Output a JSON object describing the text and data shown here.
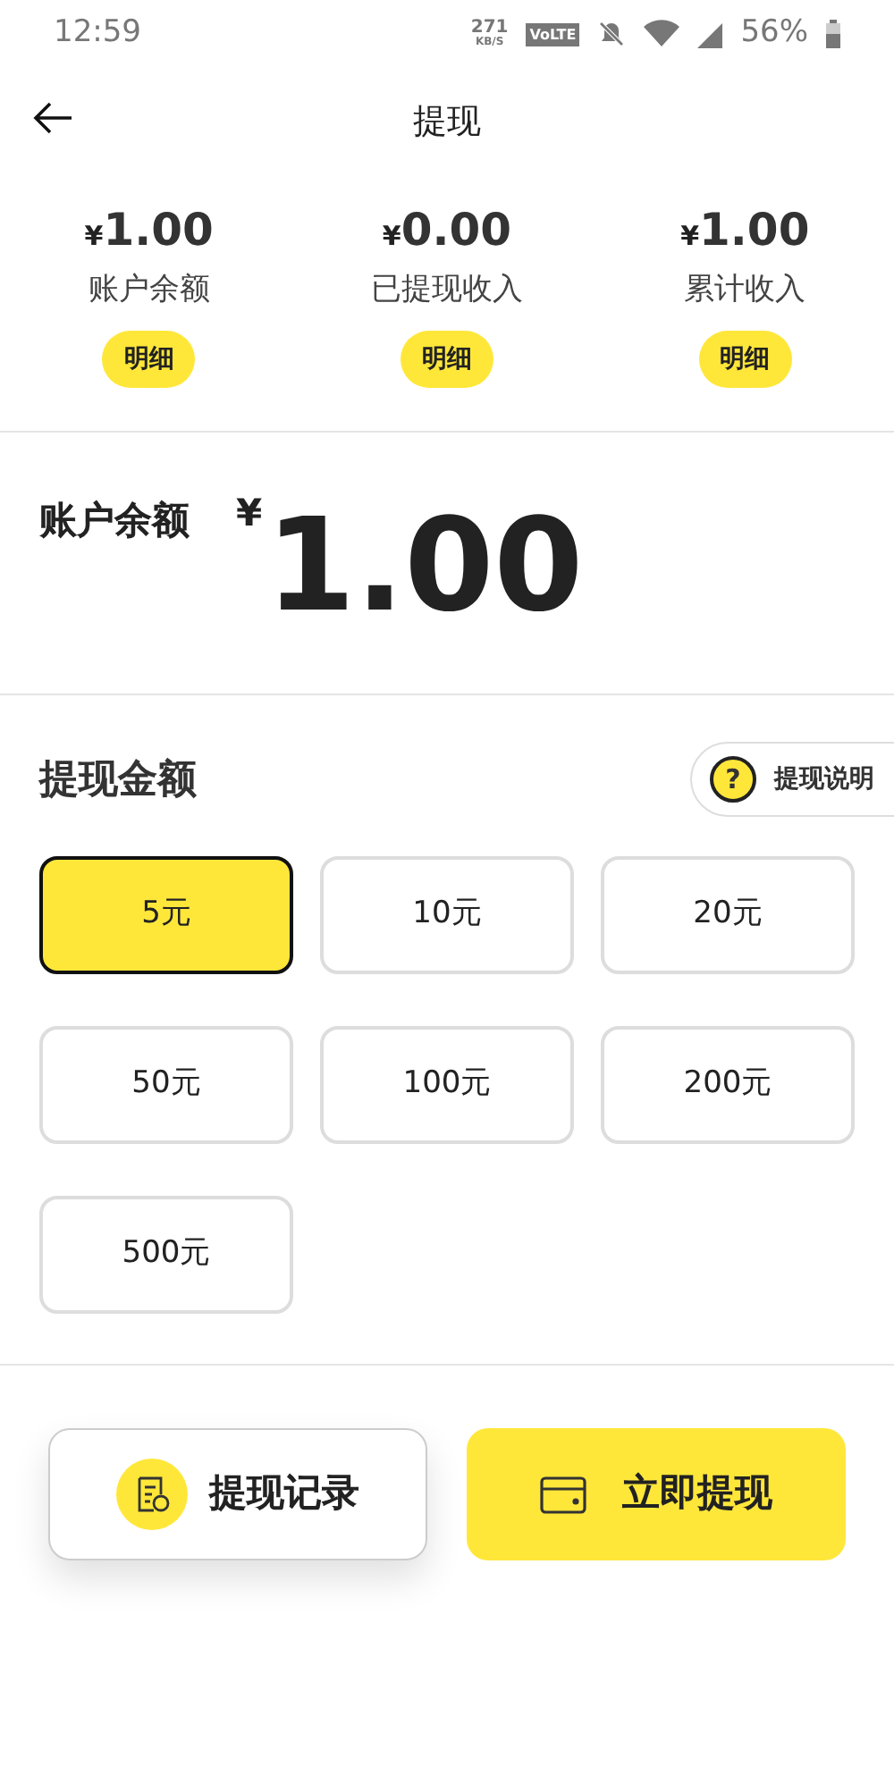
{
  "status_bar": {
    "time": "12:59",
    "speed": "271",
    "speed_unit": "KB/S",
    "network": "VoLTE",
    "battery": "56%"
  },
  "header": {
    "title": "提现"
  },
  "stats": [
    {
      "currency": "¥",
      "amount": "1.00",
      "label": "账户余额",
      "button": "明细"
    },
    {
      "currency": "¥",
      "amount": "0.00",
      "label": "已提现收入",
      "button": "明细"
    },
    {
      "currency": "¥",
      "amount": "1.00",
      "label": "累计收入",
      "button": "明细"
    }
  ],
  "balance": {
    "label": "账户余额",
    "currency": "¥",
    "amount": "1.00"
  },
  "amount_section": {
    "title": "提现金额",
    "help_button": "提现说明",
    "help_icon": "?"
  },
  "amounts": [
    {
      "label": "5元",
      "selected": true
    },
    {
      "label": "10元",
      "selected": false
    },
    {
      "label": "20元",
      "selected": false
    },
    {
      "label": "50元",
      "selected": false
    },
    {
      "label": "100元",
      "selected": false
    },
    {
      "label": "200元",
      "selected": false
    },
    {
      "label": "500元",
      "selected": false
    }
  ],
  "actions": {
    "records": "提现记录",
    "withdraw": "立即提现"
  }
}
